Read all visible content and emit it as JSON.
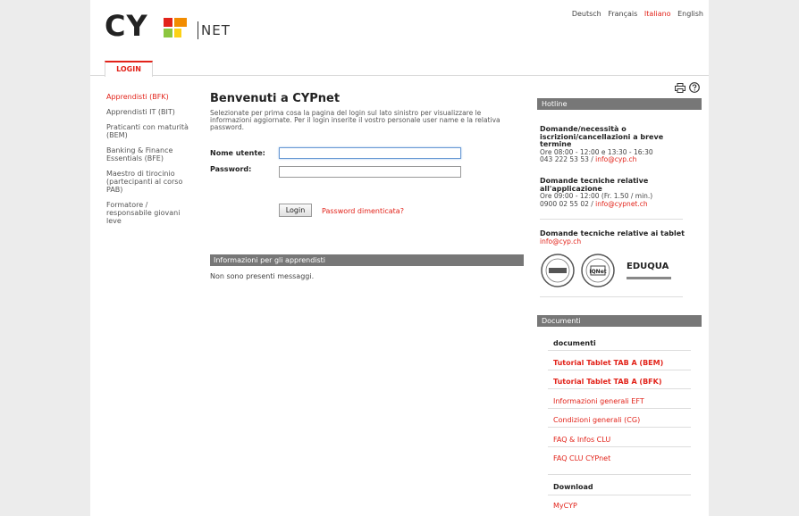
{
  "logo": {
    "text": "CY",
    "net": "NET"
  },
  "languages": [
    {
      "label": "Deutsch",
      "active": false
    },
    {
      "label": "Français",
      "active": false
    },
    {
      "label": "Italiano",
      "active": true
    },
    {
      "label": "English",
      "active": false
    }
  ],
  "tabs": {
    "login": "LOGIN"
  },
  "sidebar": {
    "items": [
      {
        "label": "Apprendisti (BFK)"
      },
      {
        "label": "Apprendisti IT (BIT)"
      },
      {
        "label": "Praticanti con maturità (BEM)"
      },
      {
        "label": "Banking & Finance Essentials (BFE)"
      },
      {
        "label": "Maestro di tirocinio (partecipanti al corso PAB)"
      },
      {
        "label": "Formatore / responsabile giovani leve"
      }
    ]
  },
  "main": {
    "title": "Benvenuti a CYPnet",
    "intro": "Selezionate per prima cosa la pagina del login sul lato sinistro per visualizzare le informazioni aggiornate. Per il login inserite il vostro personale user name e la relativa password.",
    "username_label": "Nome utente:",
    "password_label": "Password:",
    "username_value": "",
    "password_value": "",
    "login_button": "Login",
    "forgot_link": "Password dimenticata?",
    "info_title": "Informazioni per gli apprendisti",
    "no_messages": "Non sono presenti messaggi."
  },
  "hotline": {
    "title": "Hotline",
    "block1_title": "Domande/necessità o iscrizioni/cancellazioni a breve termine",
    "block1_hours": "Ore 08:00 - 12:00 e 13:30 - 16:30",
    "block1_phone": "043 222 53 53 /",
    "block1_email": "info@cyp.ch",
    "block2_title": "Domande tecniche relative all'applicazione",
    "block2_hours": "Ore 09:00 - 12:00 (Fr. 1.50 / min.)",
    "block2_phone": "0900 02 55 02 /",
    "block2_email": "info@cypnet.ch",
    "block3_title": "Domande tecniche relative ai tablet",
    "block3_email": "info@cyp.ch",
    "cert_eduqua": "EDUQUA",
    "cert_iqnet": "IQNet"
  },
  "documents": {
    "title": "Documenti",
    "head1": "documenti",
    "links": [
      {
        "label": "Tutorial Tablet TAB A (BEM)"
      },
      {
        "label": "Tutorial Tablet TAB A (BFK)"
      },
      {
        "label": "Informazioni generali EFT"
      },
      {
        "label": "Condizioni generali (CG)"
      },
      {
        "label": "FAQ & Infos CLU"
      },
      {
        "label": "FAQ CLU CYPnet"
      }
    ],
    "head2": "Download",
    "download_links": [
      {
        "label": "MyCYP"
      }
    ]
  }
}
